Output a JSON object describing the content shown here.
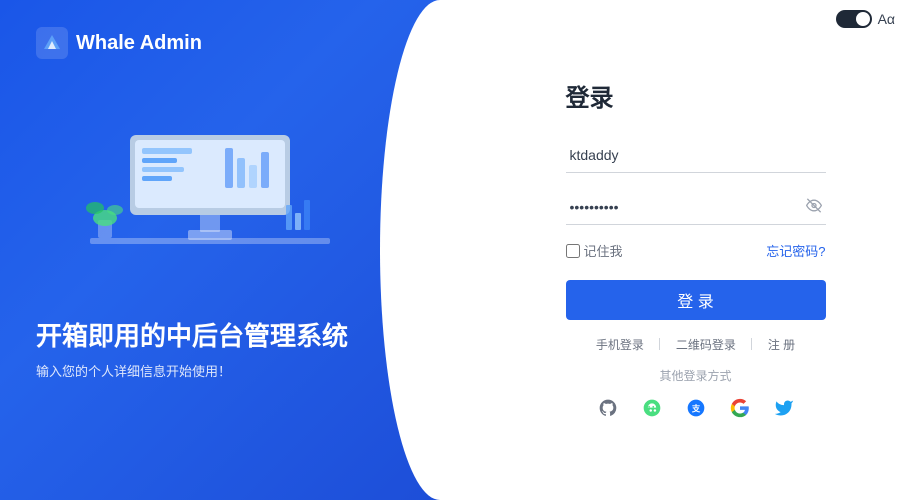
{
  "app": {
    "title": "Whale Admin"
  },
  "topRight": {
    "toggle_label": "dark mode toggle",
    "lang_label": "Aα"
  },
  "left": {
    "logo_text": "Whale Admin",
    "main_title": "开箱即用的中后台管理系统",
    "sub_title": "输入您的个人详细信息开始使用！"
  },
  "right": {
    "form_title": "登录",
    "username_placeholder": "ktdaddy",
    "username_value": "ktdaddy",
    "password_placeholder": "••••••••••",
    "remember_label": "记住我",
    "forgot_label": "忘记密码?",
    "login_btn": "登 录",
    "alt_login": {
      "phone": "手机登录",
      "qr": "二维码登录",
      "register": "注 册"
    },
    "other_label": "其他登录方式",
    "social_icons": [
      "github",
      "wechat",
      "alipay",
      "google",
      "twitter"
    ]
  }
}
